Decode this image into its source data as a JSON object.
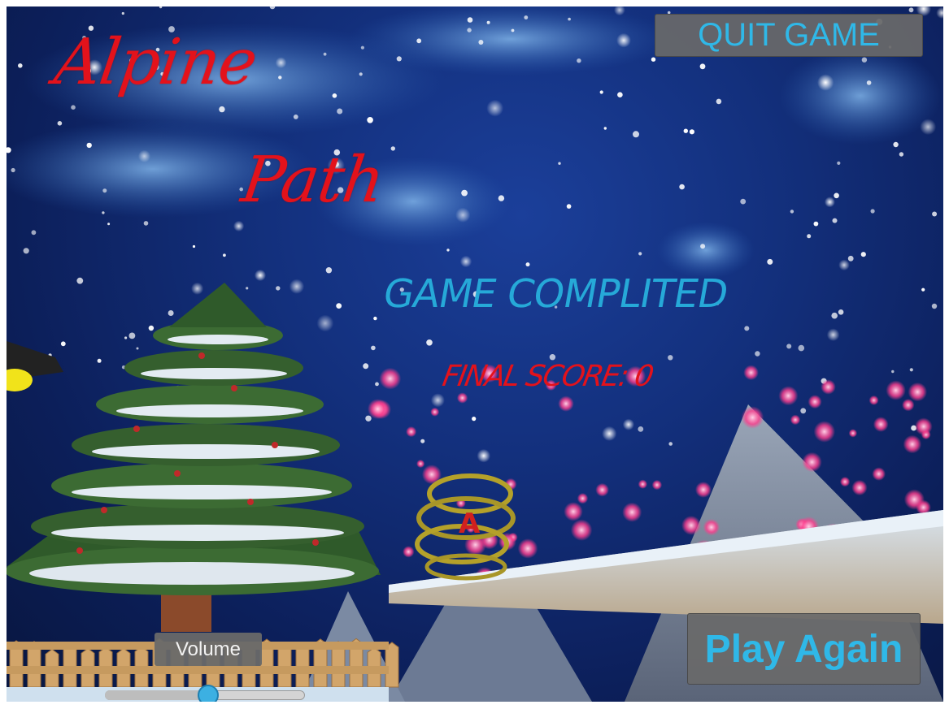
{
  "game": {
    "title_line1": "Alpine",
    "title_line2": "Path",
    "status": "GAME COMPLITED",
    "final_score": "FINAL SCORE: 0"
  },
  "buttons": {
    "quit": "QUIT GAME",
    "play_again": "Play Again"
  },
  "volume": {
    "label": "Volume",
    "level": 0.52
  },
  "colors": {
    "title": "#e3121b",
    "status": "#26a9d8",
    "score": "#e3121b",
    "button_text": "#2fb8e8",
    "button_bg": "#696969"
  }
}
